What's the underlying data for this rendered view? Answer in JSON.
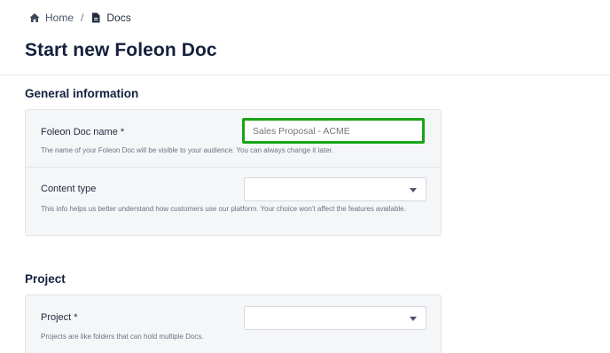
{
  "breadcrumb": {
    "home_label": "Home",
    "separator": "/",
    "docs_label": "Docs"
  },
  "page": {
    "title": "Start new Foleon Doc"
  },
  "general": {
    "heading": "General information",
    "doc_name": {
      "label": "Foleon Doc name *",
      "placeholder": "Sales Proposal - ACME",
      "help": "The name of your Foleon Doc will be visible to your audience. You can always change it later."
    },
    "content_type": {
      "label": "Content type",
      "selected": "",
      "help": "This info helps us better understand how customers use our platform. Your choice won't affect the features available."
    }
  },
  "project": {
    "heading": "Project",
    "project_field": {
      "label": "Project *",
      "selected": "",
      "help": "Projects are like folders that can hold multiple Docs."
    }
  },
  "colors": {
    "highlight": "#1aa31a",
    "heading": "#14213d",
    "card_bg": "#f5f6f8"
  },
  "icons": {
    "home": "home-icon",
    "docs": "document-icon",
    "select": "chevron-down-icon"
  }
}
